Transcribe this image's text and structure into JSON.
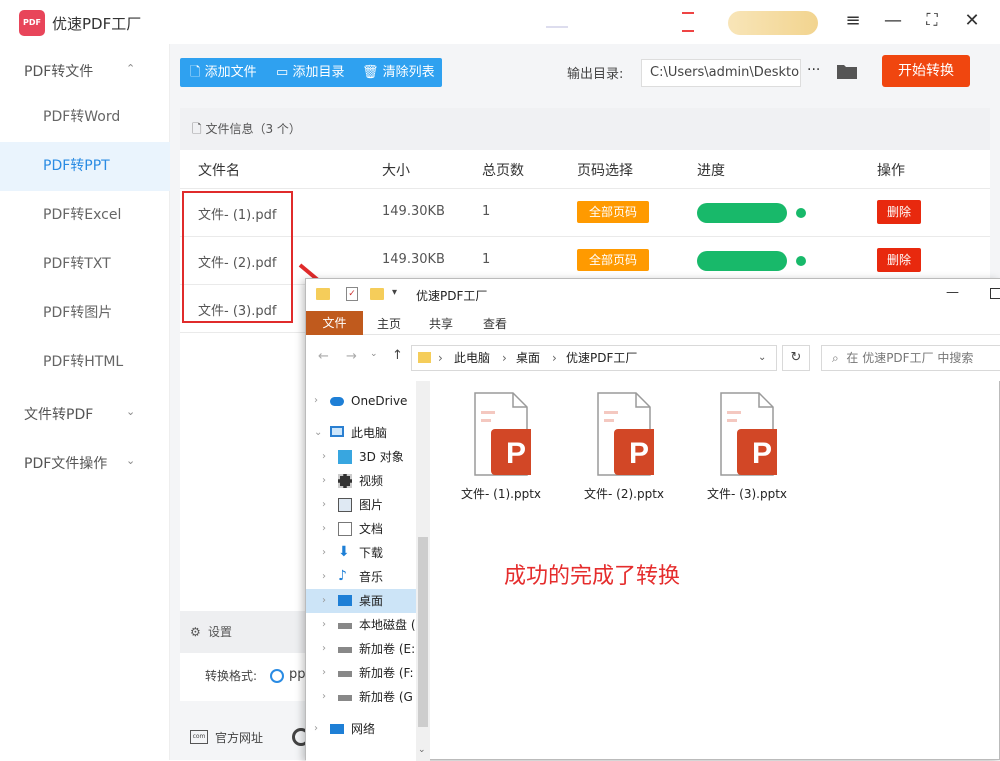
{
  "app": {
    "title": "优速PDF工厂",
    "logo_text": "PDF"
  },
  "sidebar": {
    "groups": [
      {
        "label": "PDF转文件",
        "chevron": "^"
      },
      {
        "label": "文件转PDF",
        "chevron": "v"
      },
      {
        "label": "PDF文件操作",
        "chevron": "v"
      }
    ],
    "items": [
      {
        "label": "PDF转Word",
        "active": false
      },
      {
        "label": "PDF转PPT",
        "active": true
      },
      {
        "label": "PDF转Excel",
        "active": false
      },
      {
        "label": "PDF转TXT",
        "active": false
      },
      {
        "label": "PDF转图片",
        "active": false
      },
      {
        "label": "PDF转HTML",
        "active": false
      }
    ]
  },
  "toolbar": {
    "add_file": "添加文件",
    "add_dir": "添加目录",
    "clear_list": "清除列表",
    "output_label": "输出目录:",
    "output_path": "C:\\Users\\admin\\Deskto",
    "more": "···",
    "start": "开始转换"
  },
  "file_info": {
    "label": "文件信息（3 个）"
  },
  "table": {
    "headers": [
      "文件名",
      "大小",
      "总页数",
      "页码选择",
      "进度",
      "操作"
    ],
    "rows": [
      {
        "name": "文件- (1).pdf",
        "size": "149.30KB",
        "pages": "1",
        "page_sel": "全部页码",
        "progress": 1.0,
        "action": "删除"
      },
      {
        "name": "文件- (2).pdf",
        "size": "149.30KB",
        "pages": "1",
        "page_sel": "全部页码",
        "progress": 1.0,
        "action": "删除"
      },
      {
        "name": "文件- (3).pdf"
      }
    ]
  },
  "settings": {
    "label": "设置",
    "format_label": "转换格式:",
    "format_value": "pp"
  },
  "footer": {
    "website": "官方网址"
  },
  "explorer": {
    "title": "优速PDF工厂",
    "ribbon_tabs": [
      "文件",
      "主页",
      "共享",
      "查看"
    ],
    "breadcrumb": [
      "此电脑",
      "桌面",
      "优速PDF工厂"
    ],
    "search_placeholder": "在 优速PDF工厂 中搜索",
    "tree": [
      {
        "label": "OneDrive",
        "icon": "cloud-icon",
        "indent": 0
      },
      {
        "label": "此电脑",
        "icon": "pc-icon",
        "indent": 0,
        "expanded": true
      },
      {
        "label": "3D 对象",
        "icon": "cube-icon",
        "indent": 1
      },
      {
        "label": "视频",
        "icon": "video-icon",
        "indent": 1
      },
      {
        "label": "图片",
        "icon": "picture-icon",
        "indent": 1
      },
      {
        "label": "文档",
        "icon": "document-icon",
        "indent": 1
      },
      {
        "label": "下载",
        "icon": "download-icon",
        "indent": 1
      },
      {
        "label": "音乐",
        "icon": "music-icon",
        "indent": 1
      },
      {
        "label": "桌面",
        "icon": "desktop-icon",
        "indent": 1,
        "selected": true
      },
      {
        "label": "本地磁盘 (",
        "icon": "drive-icon",
        "indent": 1
      },
      {
        "label": "新加卷 (E:",
        "icon": "drive-icon",
        "indent": 1
      },
      {
        "label": "新加卷 (F:",
        "icon": "drive-icon",
        "indent": 1
      },
      {
        "label": "新加卷 (G",
        "icon": "drive-icon",
        "indent": 1
      },
      {
        "label": "网络",
        "icon": "network-icon",
        "indent": 0
      }
    ],
    "files": [
      {
        "name": "文件- (1).pptx",
        "icon_letter": "P"
      },
      {
        "name": "文件- (2).pptx",
        "icon_letter": "P"
      },
      {
        "name": "文件- (3).pptx",
        "icon_letter": "P"
      }
    ]
  },
  "annotation": {
    "success_text": "成功的完成了转换"
  },
  "colors": {
    "accent": "#2fa1f0",
    "start": "#f0460f",
    "badge": "#ff9a00",
    "progress": "#18b96a",
    "delete": "#e8290e",
    "annotation": "#e02b2b",
    "ppt": "#d24726"
  }
}
